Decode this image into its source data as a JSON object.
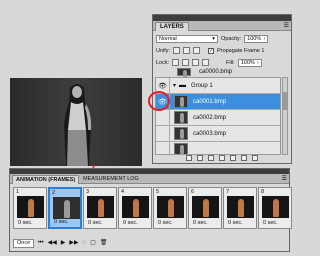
{
  "layers_panel": {
    "tab_label": "LAYERS",
    "menu_icon": "panel-menu-icon",
    "blend_mode": "Normal",
    "opacity_label": "Opacity:",
    "opacity_value": "100%",
    "unify_label": "Unify:",
    "propagate_label": "Propagate Frame 1",
    "lock_label": "Lock:",
    "fill_label": "Fill:",
    "fill_value": "100%",
    "layers": [
      {
        "name": "Group 1",
        "type": "group"
      },
      {
        "name": "ca0001.bmp",
        "selected": true
      },
      {
        "name": "ca0002.bmp"
      },
      {
        "name": "ca0003.bmp"
      }
    ],
    "top_layer_name": "ca0000.bmp"
  },
  "animation_panel": {
    "tabs": [
      "ANIMATION (FRAMES)",
      "MEASUREMENT LOG"
    ],
    "frames": [
      {
        "num": "1",
        "time": "0 sec."
      },
      {
        "num": "2",
        "time": "0 sec.",
        "active": true
      },
      {
        "num": "3",
        "time": "0 sec."
      },
      {
        "num": "4",
        "time": "0 sec."
      },
      {
        "num": "5",
        "time": "0 sec."
      },
      {
        "num": "6",
        "time": "0 sec."
      },
      {
        "num": "7",
        "time": "0 sec."
      },
      {
        "num": "8",
        "time": "0 sec."
      }
    ],
    "loop_option": "Once"
  },
  "colors": {
    "selection": "#3b8fdd",
    "annotation": "#e0202a"
  }
}
